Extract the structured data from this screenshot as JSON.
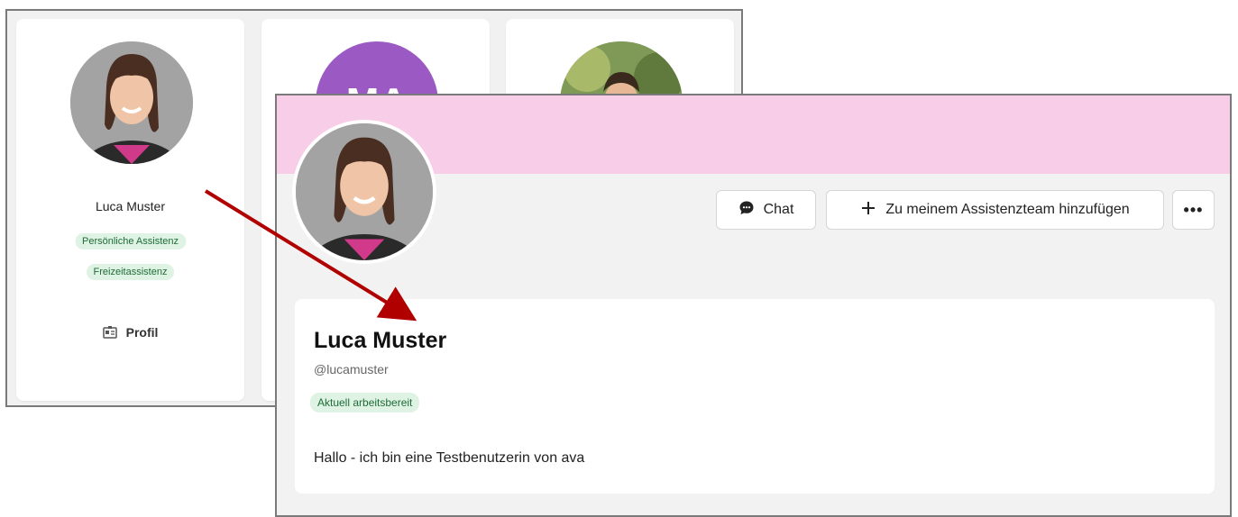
{
  "back": {
    "card1": {
      "name": "Luca Muster",
      "badges": [
        "Persönliche Assistenz",
        "Freizeitassistenz"
      ],
      "profile_label": "Profil"
    },
    "card2": {
      "initials": "MA"
    }
  },
  "front": {
    "buttons": {
      "chat": "Chat",
      "add_team": "Zu meinem Assistenzteam hinzufügen",
      "more": "•••"
    },
    "profile": {
      "name": "Luca Muster",
      "handle": "@lucamuster",
      "status": "Aktuell arbeitsbereit",
      "bio": "Hallo - ich bin eine Testbenutzerin von ava"
    }
  },
  "colors": {
    "banner": "#f8cde7",
    "badge_bg": "#dff3e4",
    "badge_text": "#1f6b37",
    "arrow": "#b00000",
    "ma_avatar": "#9b59c4"
  }
}
